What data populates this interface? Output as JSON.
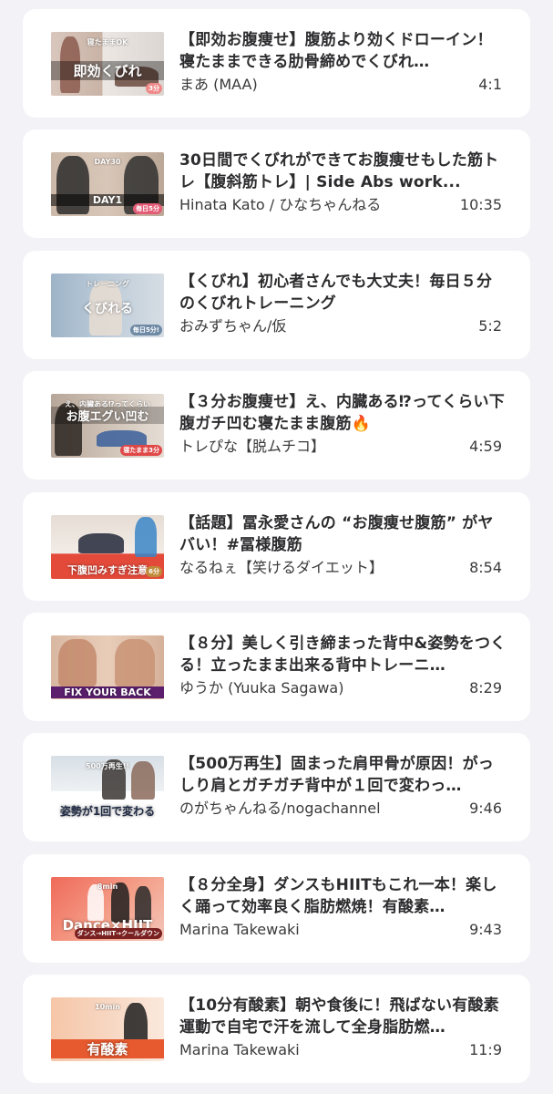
{
  "videos": [
    {
      "title": "【即効お腹痩せ】腹筋より効くドローイン！寝たままできる肋骨締めでくびれ…",
      "channel": "まあ (MAA)",
      "duration": "4:1",
      "thumb_caption": "即効くびれ",
      "thumb_sub": "寝たままOK",
      "thumb_badge": "3分"
    },
    {
      "title": "30日間でくびれができてお腹痩せもした筋トレ【腹斜筋トレ】| Side Abs work...",
      "channel": "Hinata Kato / ひなちゃんねる",
      "duration": "10:35",
      "thumb_caption": "DAY1",
      "thumb_sub": "DAY30",
      "thumb_badge": "毎日5分"
    },
    {
      "title": "【くびれ】初心者さんでも大丈夫！毎日５分のくびれトレーニング",
      "channel": "おみずちゃん/仮",
      "duration": "5:2",
      "thumb_caption": "くびれる",
      "thumb_sub": "トレーニング",
      "thumb_badge": "毎日5分!"
    },
    {
      "title": "【３分お腹痩せ】え、内臓ある⁉ってくらい下腹ガチ凹む寝たまま腹筋🔥",
      "channel": "トレぴな【脱ムチコ】",
      "duration": "4:59",
      "thumb_caption": "お腹エグい凹む",
      "thumb_sub": "え、内臓ある⁉ってくらい",
      "thumb_badge": "寝たまま3分"
    },
    {
      "title": "【話題】冨永愛さんの “お腹痩せ腹筋” がヤバい！#冨様腹筋",
      "channel": "なるねぇ【笑けるダイエット】",
      "duration": "8:54",
      "thumb_caption": "下腹凹みすぎ注意",
      "thumb_sub": "",
      "thumb_badge": "6分"
    },
    {
      "title": "【８分】美しく引き締まった背中&姿勢をつくる！立ったまま出来る背中トレーニ…",
      "channel": "ゆうか (Yuuka Sagawa)",
      "duration": "8:29",
      "thumb_caption": "FIX YOUR BACK",
      "thumb_sub": "",
      "thumb_badge": ""
    },
    {
      "title": "【500万再生】固まった肩甲骨が原因！がっしり肩とガチガチ背中が１回で変わっ…",
      "channel": "のがちゃんねる/nogachannel",
      "duration": "9:46",
      "thumb_caption": "姿勢が1回で変わる",
      "thumb_sub": "500万再生!!",
      "thumb_badge": ""
    },
    {
      "title": "【８分全身】ダンスもHIITもこれ一本！楽しく踊って効率良く脂肪燃焼！有酸素…",
      "channel": "Marina Takewaki",
      "duration": "9:43",
      "thumb_caption": "Dance×HIIT",
      "thumb_sub": "8min",
      "thumb_badge": "ダンス→HIIT→クールダウン"
    },
    {
      "title": "【10分有酸素】朝や食後に！飛ばない有酸素運動で自宅で汗を流して全身脂肪燃…",
      "channel": "Marina Takewaki",
      "duration": "11:9",
      "thumb_caption": "有酸素",
      "thumb_sub": "10min",
      "thumb_badge": "燃やすなら"
    }
  ]
}
